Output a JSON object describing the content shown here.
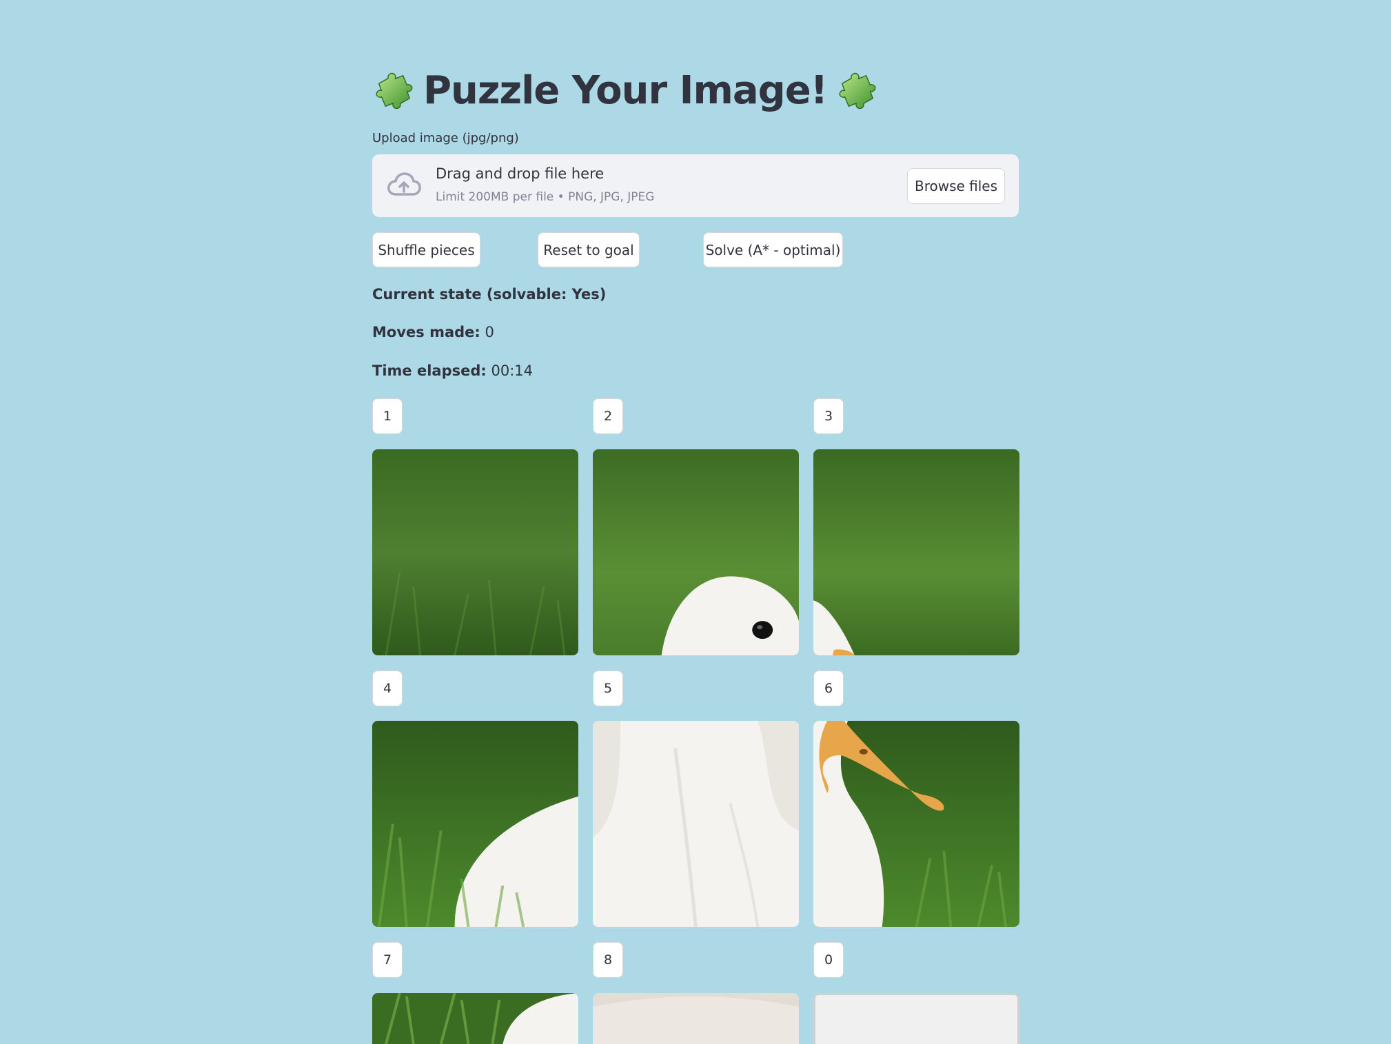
{
  "title": {
    "text": "Puzzle Your Image!",
    "left_icon": "puzzle-piece-icon",
    "right_icon": "puzzle-piece-icon"
  },
  "upload": {
    "label": "Upload image (jpg/png)",
    "drop_text": "Drag and drop file here",
    "limit_text": "Limit 200MB per file • PNG, JPG, JPEG",
    "browse_label": "Browse files",
    "icon": "cloud-upload-icon"
  },
  "controls": {
    "shuffle_label": "Shuffle pieces",
    "reset_label": "Reset to goal",
    "solve_label": "Solve (A* - optimal)"
  },
  "status": {
    "current_state": "Current state (solvable: Yes)",
    "moves_label": "Moves made:",
    "moves_value": "0",
    "time_label": "Time elapsed:",
    "time_value": "00:14"
  },
  "board": {
    "tiles": [
      {
        "label": "1"
      },
      {
        "label": "2"
      },
      {
        "label": "3"
      },
      {
        "label": "4"
      },
      {
        "label": "5"
      },
      {
        "label": "6"
      },
      {
        "label": "7"
      },
      {
        "label": "8"
      },
      {
        "label": "0"
      }
    ]
  },
  "colors": {
    "background": "#add8e6",
    "grass_dark": "#2f5a1c",
    "grass_light": "#5b8f35",
    "duck_white": "#f5f3ef",
    "beak_orange": "#e8a64a"
  }
}
